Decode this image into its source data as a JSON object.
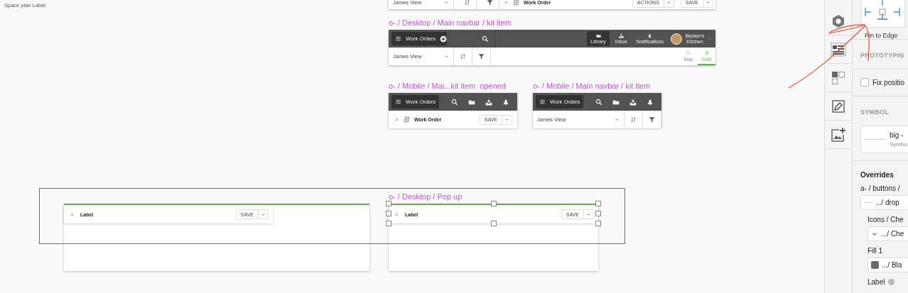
{
  "canvas": {
    "top_bar": {
      "view": "James View",
      "title": "Work Order",
      "buttons": [
        "ACTIONS",
        "SAVE"
      ]
    },
    "space_plan_card": {
      "label": "Space plan Label"
    },
    "artboards": [
      {
        "kind": "desktop_navbar",
        "label": "o- / Desktop / Main navbar / kit item",
        "nav_title": "Work Orders",
        "nav_items": [
          {
            "label": "Library",
            "selected": true
          },
          {
            "label": "Inbox",
            "selected": false
          },
          {
            "label": "Notifications",
            "selected": false
          }
        ],
        "account": "Becker's Kitchen",
        "view": "James View",
        "view_modes": [
          {
            "label": "Map",
            "selected": false
          },
          {
            "label": "Grid",
            "selected": true
          }
        ]
      },
      {
        "kind": "mobile_opened",
        "label": "o- / Mobile / Mai...kit item  opened",
        "nav_title": "Work Orders",
        "title": "Work Order",
        "save": "SAVE"
      },
      {
        "kind": "mobile_navbar",
        "label": "o- / Mobile / Main navbar / kit item",
        "nav_title": "Work Orders",
        "view": "James View"
      }
    ],
    "popups": [
      {
        "title": "Label",
        "save": "SAVE",
        "selected": false
      },
      {
        "label": "o- / Desktop / Pop up",
        "title": "Label",
        "save": "SAVE",
        "selected": true
      }
    ]
  },
  "inspector": {
    "pin_caption": "Pin to Edge",
    "items": [
      {
        "kind": "heading",
        "text": "PROTOTYPIN"
      },
      {
        "kind": "checkbox",
        "text": "Fix positio",
        "checked": false
      },
      {
        "kind": "heading",
        "text": "SYMBOL"
      },
      {
        "kind": "symbol",
        "text": "big -",
        "sub": "Symbo"
      },
      {
        "kind": "title",
        "text": "Overrides"
      },
      {
        "kind": "group",
        "text": "a- / buttons /",
        "value": ".../ drop",
        "children": [
          {
            "kind": "chevron_dropdown",
            "text": "Icons / Che",
            "value": ".../ Che"
          },
          {
            "kind": "color_dropdown",
            "text": "Fill 1",
            "value": ".../ Bla",
            "color": "#6b6b6b"
          },
          {
            "kind": "linked_label",
            "text": "Label"
          }
        ]
      }
    ]
  }
}
